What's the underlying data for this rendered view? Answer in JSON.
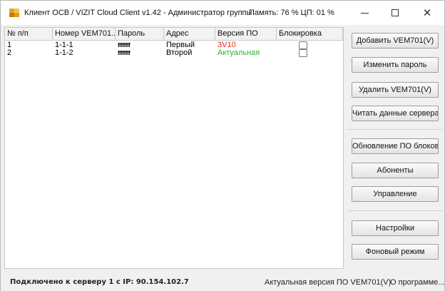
{
  "window": {
    "title": "Клиент ОСВ / VIZIT Cloud Client v1.42 - Администратор группы",
    "resources": "Память: 76 %  ЦП: 01 %",
    "icon": "app-grid-icon"
  },
  "table": {
    "headers": [
      "№ п/п",
      "Номер VEM701...",
      "Пароль",
      "Адрес",
      "Версия ПО",
      "Блокировка"
    ],
    "rows": [
      {
        "num": "1",
        "vem": "1-1-1",
        "password": "ffffffff",
        "address": "Первый",
        "version": "3V10",
        "version_color": "#e8251a",
        "locked": false
      },
      {
        "num": "2",
        "vem": "1-1-2",
        "password": "ffffffff",
        "address": "Второй",
        "version": "Актуальная",
        "version_color": "#2db32d",
        "locked": false
      }
    ]
  },
  "buttons": {
    "add": "Добавить VEM701(V)",
    "change_password": "Изменить пароль",
    "delete": "Удалить VEM701(V)",
    "read_server": "Читать данные сервера",
    "update_firmware": "Обновление ПО блоков",
    "subscribers": "Абоненты",
    "control": "Управление",
    "settings": "Настройки",
    "background": "Фоновый режим"
  },
  "status": {
    "connection": "Подключено к серверу 1 с IP:  90.154.102.7",
    "current_version": "Актуальная версия ПО VEM701(V)",
    "about": "О программе..."
  }
}
